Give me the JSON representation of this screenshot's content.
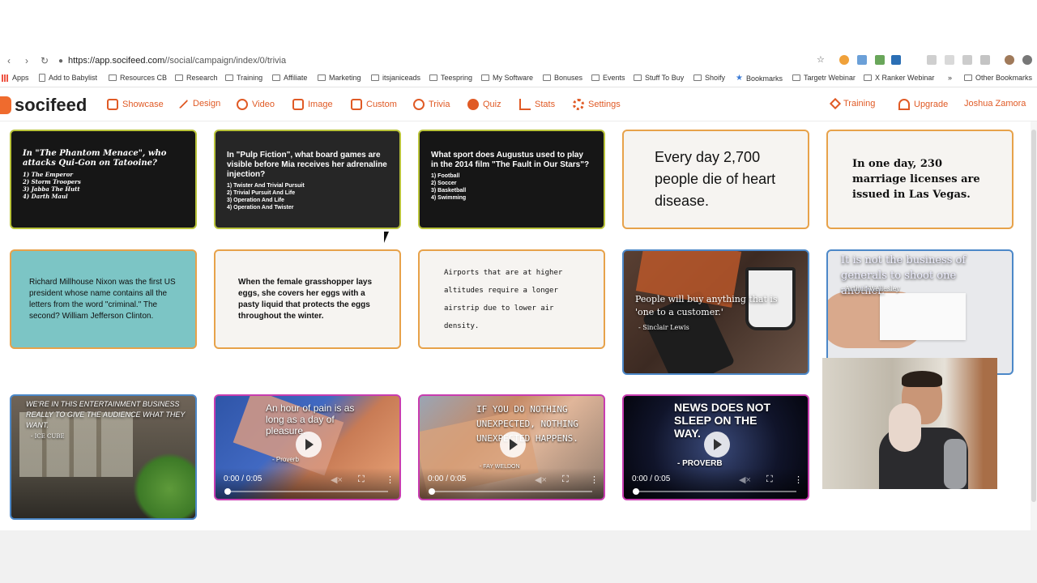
{
  "browser": {
    "url_host": "https://app.socifeed.com",
    "url_path": "//social/campaign/index/0/trivia",
    "bookmarks": [
      "Apps",
      "Add to Babylist",
      "Resources CB",
      "Research",
      "Training",
      "Affiliate",
      "Marketing",
      "itsjaniceads",
      "Teespring",
      "My Software",
      "Bonuses",
      "Events",
      "Stuff To Buy",
      "Shoify",
      "Bookmarks",
      "Targetr Webinar",
      "X Ranker Webinar",
      "»",
      "Other Bookmarks"
    ]
  },
  "app": {
    "logo": "socifeed",
    "nav": [
      "Showcase",
      "Design",
      "Video",
      "Image",
      "Custom",
      "Trivia",
      "Quiz",
      "Stats",
      "Settings"
    ],
    "right_nav": [
      "Training",
      "Upgrade",
      "Joshua Zamora"
    ]
  },
  "cards": {
    "c1": {
      "question": "In \"The Phantom Menace\", who attacks Qui-Gon on Tatooine?",
      "options": [
        "1) The Emperor",
        "2) Storm Troopers",
        "3) Jabba The Hutt",
        "4) Darth Maul"
      ]
    },
    "c2": {
      "question": "In \"Pulp Fiction\", what board games are visible before Mia receives her adrenaline injection?",
      "options": [
        "1) Twister And Trivial Pursuit",
        "2) Trivial Pursuit And Life",
        "3) Operation And Life",
        "4) Operation And Twister"
      ]
    },
    "c3": {
      "question": "What sport does Augustus used to play in the 2014 film \"The Fault in Our Stars\"?",
      "options": [
        "1) Football",
        "2) Soccer",
        "3) Basketball",
        "4) Swimming"
      ]
    },
    "c4": {
      "text": "Every day 2,700 people die of heart disease."
    },
    "c5": {
      "text": "In one day, 230 marriage licenses are issued in Las Vegas."
    },
    "c6": {
      "text": "Richard Millhouse Nixon was the first US president whose name contains all the letters from the word \"criminal.\" The second? William Jefferson Clinton."
    },
    "c7": {
      "text": "When the female grasshopper lays eggs, she covers her eggs with a pasty liquid that protects the eggs throughout the winter."
    },
    "c8": {
      "text": "Airports that are at higher altitudes require a longer airstrip due to lower air density."
    },
    "c9": {
      "text": "People will buy anything that is 'one to a customer.'",
      "author": "- Sinclair Lewis"
    },
    "c10": {
      "text": "It is not the business of generals to shoot one another.",
      "author": "- Arthur Wellesley"
    },
    "c11": {
      "text": "WE'RE IN THIS ENTERTAINMENT BUSINESS REALLY TO GIVE THE AUDIENCE WHAT THEY WANT.",
      "author": "- ICE CUBE"
    },
    "c12": {
      "text": "An hour of pain is as long as a day of pleasure.",
      "author": "- Proverb",
      "time": "0:00 / 0:05"
    },
    "c13": {
      "text": "IF YOU DO NOTHING UNEXPECTED, NOTHING UNEXPECTED HAPPENS.",
      "author": "- FAY WELDON",
      "time": "0:00 / 0:05"
    },
    "c14": {
      "text": "NEWS DOES NOT SLEEP ON THE WAY.",
      "author": "- PROVERB",
      "time": "0:00 / 0:05"
    }
  }
}
